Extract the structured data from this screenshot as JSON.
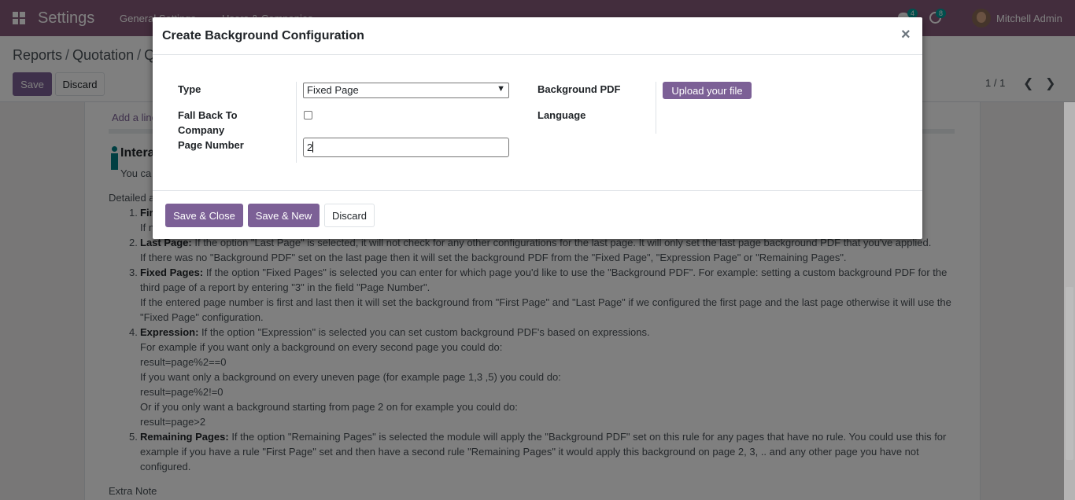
{
  "navbar": {
    "brand": "Settings",
    "menu": [
      "General Settings",
      "Users & Companies"
    ],
    "chat_badge": "4",
    "activity_badge": "8",
    "user_name": "Mitchell Admin"
  },
  "control_panel": {
    "breadcrumb": [
      "Reports",
      "Quotation",
      "Q"
    ],
    "save_label": "Save",
    "discard_label": "Discard",
    "pager": "1 / 1"
  },
  "form": {
    "add_line": "Add a line",
    "section_title": "Intera",
    "section_desc": "You ca",
    "detailed": "Detailed a",
    "items": [
      {
        "num": "1.",
        "title": "Fir",
        "lines": [
          "If n"
        ]
      },
      {
        "num": "2.",
        "title": "Last Page:",
        "lines": [
          " If the option \"Last Page\" is selected, it will not check for any other configurations for the last page. It will only set the last page background PDF that you've applied.",
          "If there was no \"Background PDF\" set on the last page then it will set the background PDF from the \"Fixed Page\", \"Expression Page\" or \"Remaining Pages\"."
        ]
      },
      {
        "num": "3.",
        "title": "Fixed Pages:",
        "lines": [
          " If the option \"Fixed Pages\" is selected you can enter for which page you'd like to use the \"Background PDF\". For example: setting a custom background PDF for the",
          "third page of a report by entering \"3\" in the field \"Page Number\".",
          "If the entered page number is first and last then it will set the background from \"First Page\" and \"Last Page\" if we configured the first page and the last page otherwise it will use the",
          "\"Fixed Page\" configuration."
        ]
      },
      {
        "num": "4.",
        "title": "Expression:",
        "lines": [
          " If the option \"Expression\" is selected you can set custom background PDF's based on expressions.",
          "For example if you want only a background on every second page you could do:",
          "result=page%2==0",
          "If you want only a background on every uneven page (for example page 1,3 ,5) you could do:",
          "result=page%2!=0",
          "Or if you only want a background starting from page 2 on for example you could do:",
          "result=page>2"
        ]
      },
      {
        "num": "5.",
        "title": "Remaining Pages:",
        "lines": [
          " If the option \"Remaining Pages\" is selected the module will apply the \"Background PDF\" set on this rule for any pages that have no rule. You could use this for",
          "example if you have a rule \"First Page\" set and then have a second rule \"Remaining Pages\" it would apply this background on page 2, 3, .. and any other page you have not",
          "configured."
        ]
      }
    ],
    "extra_note": "Extra Note"
  },
  "modal": {
    "title": "Create Background Configuration",
    "close_glyph": "×",
    "labels": {
      "type": "Type",
      "fall_back_line1": "Fall Back To",
      "fall_back_line2": "Company",
      "page_number": "Page Number",
      "background_pdf": "Background PDF",
      "language": "Language"
    },
    "type_value": "Fixed Page",
    "fall_back_checked": false,
    "page_number_value": "2",
    "upload_label": "Upload your file",
    "footer": {
      "save_close": "Save & Close",
      "save_new": "Save & New",
      "discard": "Discard"
    }
  },
  "colors": {
    "brand": "#875a7b",
    "primary_button": "#7c6096",
    "badge": "#00a09d"
  }
}
